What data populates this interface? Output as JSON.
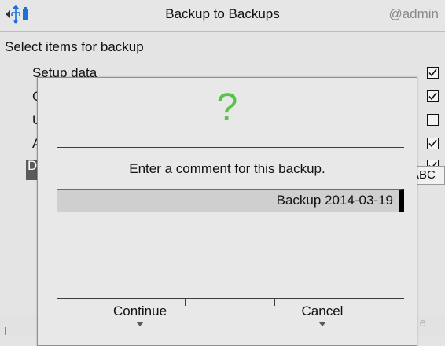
{
  "titlebar": {
    "title": "Backup to Backups",
    "user": "@admin",
    "icons": [
      "back-arrow-icon",
      "usb-icon",
      "battery-icon"
    ]
  },
  "main": {
    "heading": "Select items for backup",
    "items": [
      {
        "label": "Setup data",
        "checked": true
      },
      {
        "label": "C",
        "checked": true
      },
      {
        "label": "U",
        "checked": false
      },
      {
        "label": "A",
        "checked": true
      },
      {
        "label": "D",
        "checked": true
      }
    ],
    "input_mode": "ABC",
    "footer_ghost": "e"
  },
  "dialog": {
    "icon": "?",
    "icon_color": "#5cc14c",
    "prompt": "Enter a comment for this backup.",
    "comment_value": "Backup 2014-03-19",
    "buttons": {
      "continue": "Continue",
      "cancel": "Cancel"
    }
  }
}
